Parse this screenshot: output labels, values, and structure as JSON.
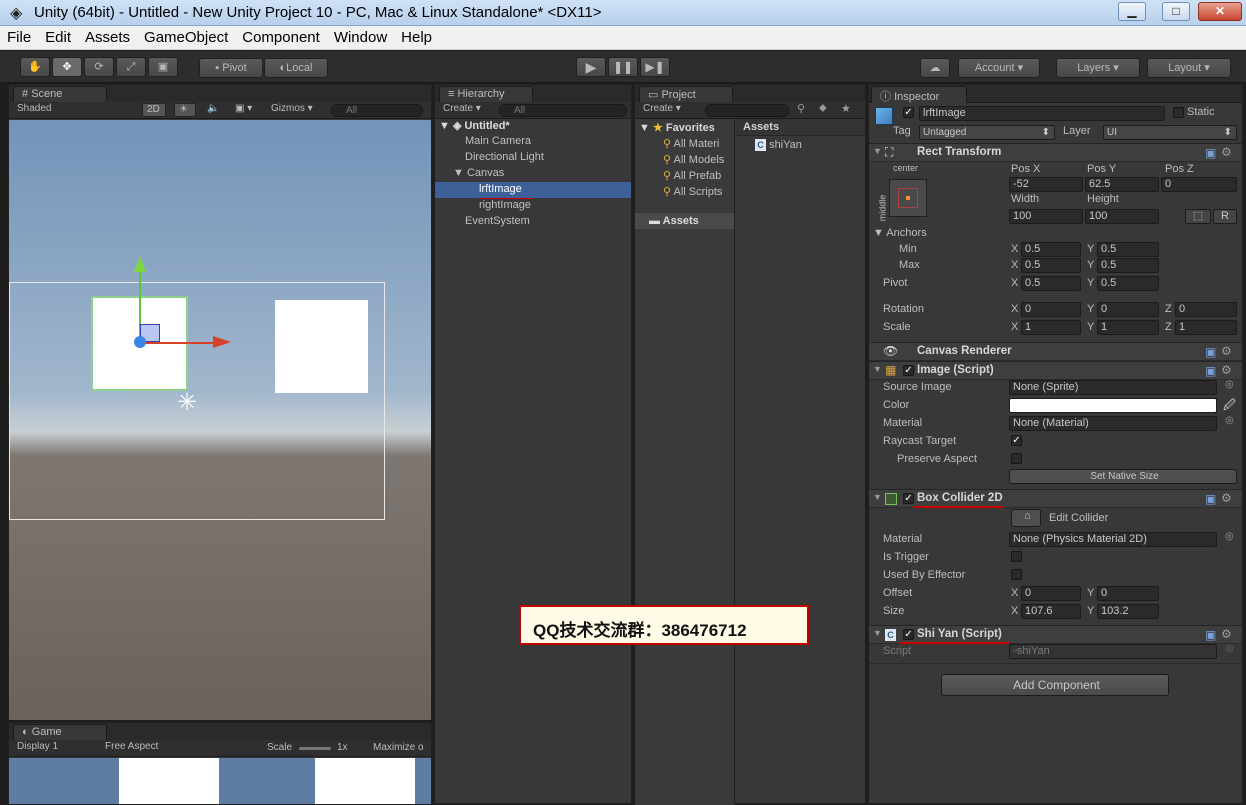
{
  "window": {
    "title": "Unity (64bit) - Untitled - New Unity Project 10 - PC, Mac & Linux Standalone* <DX11>",
    "min": "▁",
    "max": "□",
    "close": "✕"
  },
  "menu": [
    "File",
    "Edit",
    "Assets",
    "GameObject",
    "Component",
    "Window",
    "Help"
  ],
  "toolbar": {
    "pivot": "Pivot",
    "local": "Local",
    "account": "Account",
    "layers": "Layers",
    "layout": "Layout"
  },
  "scene": {
    "tab": "Scene",
    "shading": "Shaded",
    "mode2d": "2D",
    "gizmos": "Gizmos",
    "search": "All"
  },
  "game": {
    "tab": "Game",
    "display": "Display 1",
    "aspect": "Free Aspect",
    "scale": "Scale",
    "scale_val": "1x",
    "maximize": "Maximize o"
  },
  "hierarchy": {
    "tab": "Hierarchy",
    "create": "Create",
    "search": "All",
    "root": "Untitled*",
    "items": [
      "Main Camera",
      "Directional Light",
      "Canvas",
      "lrftImage",
      "rightImage",
      "EventSystem"
    ]
  },
  "project": {
    "tab": "Project",
    "create": "Create",
    "favorites": "Favorites",
    "fav_items": [
      "All Materi",
      "All Models",
      "All Prefab",
      "All Scripts"
    ],
    "assets": "Assets",
    "assets_header": "Assets",
    "file": "shiYan"
  },
  "inspector": {
    "tab": "Inspector",
    "object_name": "lrftImage",
    "static": "Static",
    "tag_label": "Tag",
    "tag": "Untagged",
    "layer_label": "Layer",
    "layer": "UI",
    "rect": {
      "title": "Rect Transform",
      "anchor": "center",
      "side": "middle",
      "posx_l": "Pos X",
      "posy_l": "Pos Y",
      "posz_l": "Pos Z",
      "posx": "-52",
      "posy": "62.5",
      "posz": "0",
      "w_l": "Width",
      "h_l": "Height",
      "w": "100",
      "h": "100",
      "r": "R",
      "anchors": "Anchors",
      "min": "Min",
      "max": "Max",
      "pivot": "Pivot",
      "minx": "0.5",
      "miny": "0.5",
      "maxx": "0.5",
      "maxy": "0.5",
      "pivx": "0.5",
      "pivy": "0.5",
      "rotation": "Rotation",
      "scale": "Scale",
      "rx": "0",
      "ry": "0",
      "rz": "0",
      "sx": "1",
      "sy": "1",
      "sz": "1"
    },
    "canvas_renderer": "Canvas Renderer",
    "image": {
      "title": "Image (Script)",
      "source_l": "Source Image",
      "source": "None (Sprite)",
      "color_l": "Color",
      "material_l": "Material",
      "material": "None (Material)",
      "raycast_l": "Raycast Target",
      "preserve_l": "Preserve Aspect",
      "native": "Set Native Size"
    },
    "box": {
      "title": "Box Collider 2D",
      "edit": "Edit Collider",
      "material_l": "Material",
      "material": "None (Physics Material 2D)",
      "trigger_l": "Is Trigger",
      "effector_l": "Used By Effector",
      "offset_l": "Offset",
      "ox": "0",
      "oy": "0",
      "size_l": "Size",
      "sx": "107.6",
      "sy": "103.2"
    },
    "script": {
      "title": "Shi Yan (Script)",
      "script_l": "Script",
      "script": "shiYan"
    },
    "add": "Add Component"
  },
  "axes": {
    "x": "X",
    "y": "Y",
    "z": "Z"
  },
  "overlay": "QQ技术交流群：386476712"
}
